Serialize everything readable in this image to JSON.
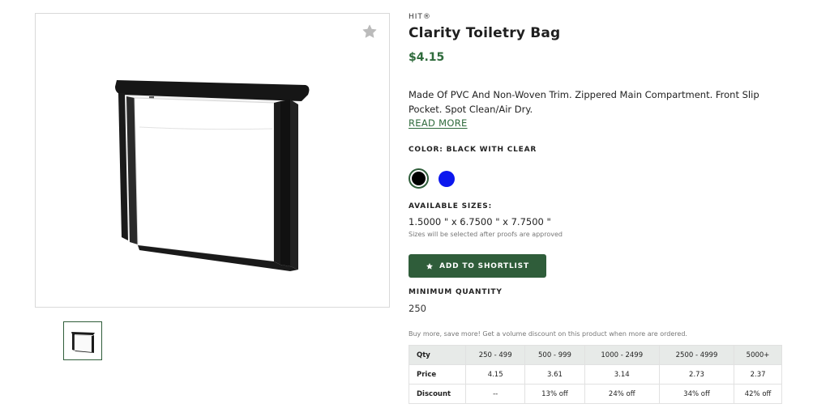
{
  "product": {
    "brand": "HIT®",
    "title": "Clarity Toiletry Bag",
    "price": "$4.15",
    "description": "Made Of PVC And Non-Woven Trim. Zippered Main Compartment. Front Slip Pocket. Spot Clean/Air Dry.",
    "read_more": "READ MORE",
    "color_label": "COLOR: BLACK WITH CLEAR",
    "colors": [
      {
        "name": "black",
        "hex": "#000000",
        "selected": true
      },
      {
        "name": "blue",
        "hex": "#0c17ee",
        "selected": false
      }
    ],
    "sizes_label": "AVAILABLE SIZES:",
    "size_value": "1.5000 \" x 6.7500 \" x 7.7500 \"",
    "size_note": "Sizes will be selected after proofs are approved",
    "shortlist_label": "ADD TO SHORTLIST",
    "min_qty_label": "MINIMUM QUANTITY",
    "min_qty_value": "250",
    "promo_text": "Buy more, save more! Get a volume discount on this product when more are ordered."
  },
  "pricing_table": {
    "header": [
      "Qty",
      "250 - 499",
      "500 - 999",
      "1000 - 2499",
      "2500 - 4999",
      "5000+"
    ],
    "rows": [
      [
        "Price",
        "4.15",
        "3.61",
        "3.14",
        "2.73",
        "2.37"
      ],
      [
        "Discount",
        "--",
        "13% off",
        "24% off",
        "34% off",
        "42% off"
      ]
    ]
  },
  "colors": {
    "accent": "#2f5d3a",
    "price": "#2f6b3c",
    "table_header_bg": "#e7eae8"
  },
  "icons": {
    "favorite": "star-icon",
    "shortlist": "star-icon"
  }
}
